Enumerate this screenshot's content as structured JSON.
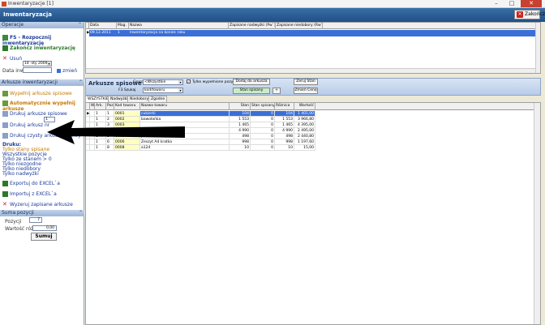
{
  "window": {
    "title": "Inwentaryzacje [1]",
    "minimize": "–",
    "maximize": "□",
    "close": "✕"
  },
  "header": {
    "title": "Inwentaryzacja",
    "close_label": "Zakończ"
  },
  "operations": {
    "title": "Operacje",
    "items": [
      "FS - Rozpocznij inwentaryzację",
      "Zakończ inwentaryzację",
      "Usuń"
    ],
    "date_value": "14 -sty 2009",
    "date_label": "Data  inw.",
    "change_label": "zmień"
  },
  "sheets_panel": {
    "title": "Arkusze inwentaryzacji",
    "items": [
      "Wypełnij arkusze spisowe",
      "Automatycznie wypełnij arkusze",
      "Drukuj  arkusze spisowe",
      "Drukuj arkusz nr",
      "Drukuj  czysty arkusz spisowy"
    ],
    "spin_value": "1",
    "print_title": "Druku:",
    "print_options": [
      "Tylko stany   spisane",
      "Wszystkie  pozycje",
      "Tylko ze stanem > 0",
      "Tylko niezgodne",
      "Tylko niedobory",
      "Tylko  nadwyżki"
    ],
    "export": "Exportuj do EXCEL`a",
    "import": "Importuj z EXCEL`a",
    "delete": "Wyzeruj zapisane   arkusze"
  },
  "summary": {
    "title": "Suma pozycji",
    "pos_label": "Pozycji",
    "pos_value": "7",
    "value_label": "Wartość różnic",
    "value_value": "0,00",
    "button": "Sumuj"
  },
  "grid1": {
    "headers": [
      "Data",
      "Mag.",
      "Nazwa",
      "Zapisane nadwyżki (Pw`)",
      "Zapisane niedobory (Rw`)"
    ],
    "row": [
      "09.12.2011",
      "1",
      "Inwentaryzacja na koniec roku",
      "",
      ""
    ]
  },
  "sheets_toolbar": {
    "title": "Arkusze spisowe",
    "group_label": "Grupa",
    "group_value": "<Wszystkie",
    "filled_checkbox": "Tylko wypełnione pozycje",
    "add_button": "Dodaj do arkusza",
    "zero_button": "Zeruj Stan",
    "sort_label": "F3 Szukaj",
    "sort_value": "kod/towaru",
    "stock_button": "Stan spisany",
    "price_button": "Zmień Cenę",
    "plus_button": "+"
  },
  "tabs": [
    "WSZYSTKIE",
    "Nadwyżki",
    "Niedobory",
    "Zgodne"
  ],
  "grid2": {
    "headers": [
      "W",
      "Ark.",
      "Poz",
      "Kod towaru",
      "Nazwa towaru",
      "Stan",
      "Stan spisany",
      "Różnica",
      "Wartość"
    ],
    "rows": [
      [
        "",
        "1",
        "1",
        "0001",
        "cukierki",
        "104",
        "0",
        "104",
        "1 401,00"
      ],
      [
        "",
        "1",
        "2",
        "0002",
        "bawołańka",
        "1 553",
        "0",
        "1 553",
        "3 966,80"
      ],
      [
        "",
        "1",
        "3",
        "0003",
        "",
        "1 465",
        "0",
        "1 465",
        "4 395,00"
      ],
      [
        "",
        "1",
        "4",
        "0004",
        "",
        "4 990",
        "0",
        "4 990",
        "2 495,00"
      ],
      [
        "",
        "1",
        "5",
        "0005",
        "pezek",
        "498",
        "0",
        "498",
        "2 440,80"
      ],
      [
        "",
        "1",
        "6",
        "0006",
        "Zeszyt A4 kratka",
        "998",
        "0",
        "998",
        "1 197,60"
      ],
      [
        "",
        "1",
        "8",
        "0008",
        "a124",
        "10",
        "0",
        "10",
        "15,00"
      ]
    ]
  }
}
